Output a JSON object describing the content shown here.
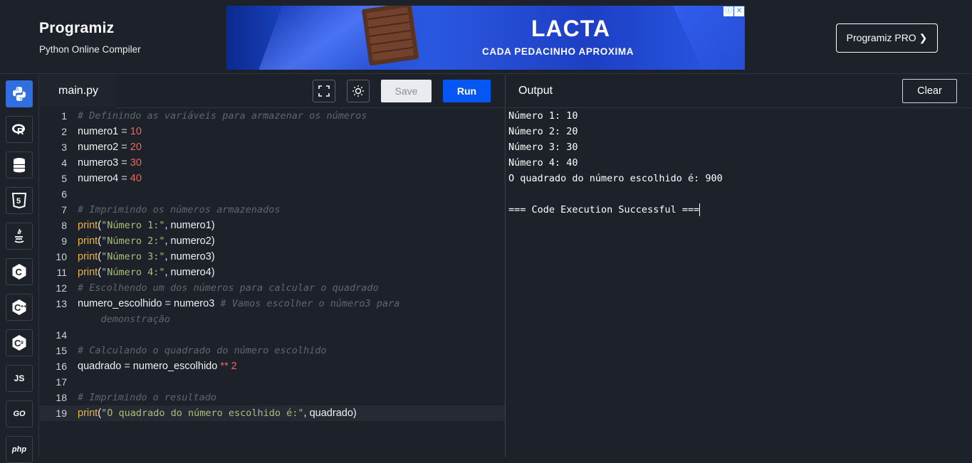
{
  "header": {
    "brand": "Programiz",
    "subtitle": "Python Online Compiler",
    "pro_button": "Programiz PRO ❯"
  },
  "ad": {
    "brand": "LACTA",
    "tagline": "CADA PEDACINHO APROXIMA"
  },
  "sidebar": {
    "languages": [
      {
        "name": "python",
        "label": ""
      },
      {
        "name": "r",
        "label": "R"
      },
      {
        "name": "sql",
        "label": ""
      },
      {
        "name": "html",
        "label": "5"
      },
      {
        "name": "java",
        "label": ""
      },
      {
        "name": "c",
        "label": "C"
      },
      {
        "name": "cpp",
        "label": "C"
      },
      {
        "name": "csharp",
        "label": "C"
      },
      {
        "name": "js",
        "label": "JS"
      },
      {
        "name": "go",
        "label": "GO"
      },
      {
        "name": "php",
        "label": "php"
      }
    ]
  },
  "editor": {
    "tab": "main.py",
    "save_label": "Save",
    "run_label": "Run",
    "lines": [
      {
        "n": "1",
        "text": "# Definindo as variáveis para armazenar os números"
      },
      {
        "n": "2",
        "text": "numero1 = 10"
      },
      {
        "n": "3",
        "text": "numero2 = 20"
      },
      {
        "n": "4",
        "text": "numero3 = 30"
      },
      {
        "n": "5",
        "text": "numero4 = 40"
      },
      {
        "n": "6",
        "text": ""
      },
      {
        "n": "7",
        "text": "# Imprimindo os números armazenados"
      },
      {
        "n": "8",
        "text": "print(\"Número 1:\", numero1)"
      },
      {
        "n": "9",
        "text": "print(\"Número 2:\", numero2)"
      },
      {
        "n": "10",
        "text": "print(\"Número 3:\", numero3)"
      },
      {
        "n": "11",
        "text": "print(\"Número 4:\", numero4)"
      },
      {
        "n": "12",
        "text": "# Escolhendo um dos números para calcular o quadrado"
      },
      {
        "n": "13",
        "text": "numero_escolhido = numero3  # Vamos escolher o número3 para demonstração"
      },
      {
        "n": "14",
        "text": ""
      },
      {
        "n": "15",
        "text": "# Calculando o quadrado do número escolhido"
      },
      {
        "n": "16",
        "text": "quadrado = numero_escolhido ** 2"
      },
      {
        "n": "17",
        "text": ""
      },
      {
        "n": "18",
        "text": "# Imprimindo o resultado"
      },
      {
        "n": "19",
        "text": "print(\"O quadrado do número escolhido é:\", quadrado)"
      }
    ]
  },
  "output": {
    "title": "Output",
    "clear_label": "Clear",
    "lines": [
      "Número 1: 10",
      "Número 2: 20",
      "Número 3: 30",
      "Número 4: 40",
      "O quadrado do número escolhido é: 900",
      "",
      "=== Code Execution Successful ==="
    ]
  }
}
